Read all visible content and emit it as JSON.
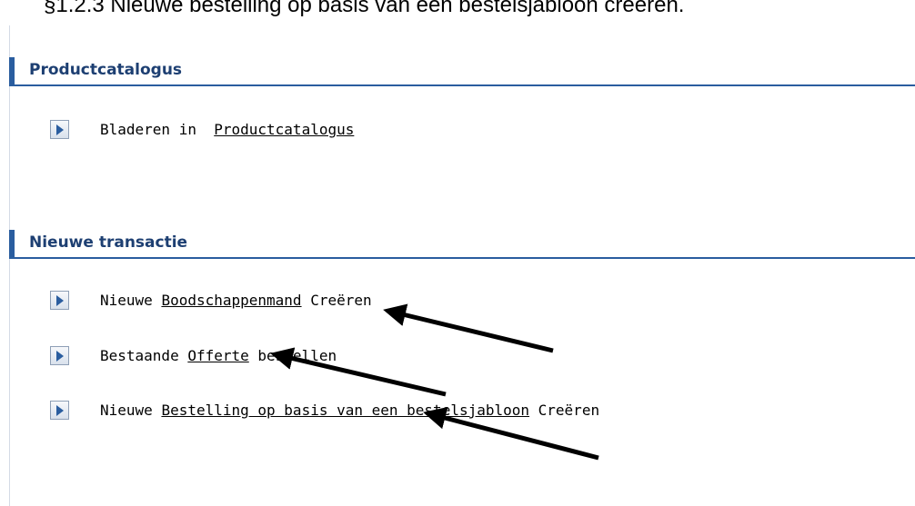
{
  "document": {
    "heading": "§1.2.3 Nieuwe bestelling op basis van een bestelsjabloon creëren."
  },
  "sections": [
    {
      "title": "Productcatalogus",
      "items": [
        {
          "prefix": "Bladeren in  ",
          "link": "Productcatalogus",
          "suffix": ""
        }
      ]
    },
    {
      "title": "Nieuwe transactie",
      "items": [
        {
          "prefix": "Nieuwe ",
          "link": "Boodschappenmand",
          "suffix": " Creëren"
        },
        {
          "prefix": "Bestaande ",
          "link": "Offerte",
          "suffix": " bestellen"
        },
        {
          "prefix": "Nieuwe ",
          "link": "Bestelling op basis van een bestelsjabloon",
          "suffix": " Creëren"
        }
      ]
    }
  ],
  "icons": {
    "row_button": "play-arrow-icon"
  },
  "colors": {
    "accent": "#2a5d9f",
    "section_title": "#1d3f72",
    "arrow": "#000000"
  }
}
